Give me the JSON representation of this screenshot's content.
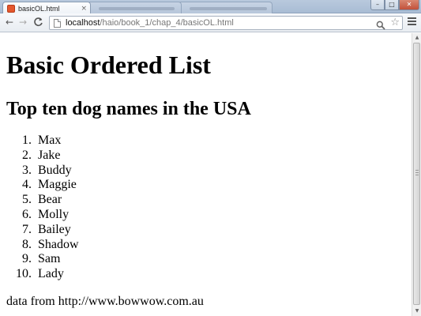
{
  "browser": {
    "tab_title": "basicOL.html",
    "tab_close": "×",
    "url_host": "localhost",
    "url_path": "/haio/book_1/chap_4/basicOL.html",
    "window_controls": {
      "minimize": "–",
      "maximize": "□",
      "close": "✕"
    },
    "nav": {
      "back": "←",
      "forward": "→",
      "reload": "C"
    },
    "star": "☆",
    "colors": {
      "tabstrip": "#b9c9dd",
      "favicon": "#e4572e",
      "close_button": "#c2513a"
    }
  },
  "page": {
    "title": "Basic Ordered List",
    "subtitle": "Top ten dog names in the USA",
    "list": [
      {
        "num": "1.",
        "name": "Max"
      },
      {
        "num": "2.",
        "name": "Jake"
      },
      {
        "num": "3.",
        "name": "Buddy"
      },
      {
        "num": "4.",
        "name": "Maggie"
      },
      {
        "num": "5.",
        "name": "Bear"
      },
      {
        "num": "6.",
        "name": "Molly"
      },
      {
        "num": "7.",
        "name": "Bailey"
      },
      {
        "num": "8.",
        "name": "Shadow"
      },
      {
        "num": "9.",
        "name": "Sam"
      },
      {
        "num": "10.",
        "name": "Lady"
      }
    ],
    "source": "data from http://www.bowwow.com.au"
  }
}
